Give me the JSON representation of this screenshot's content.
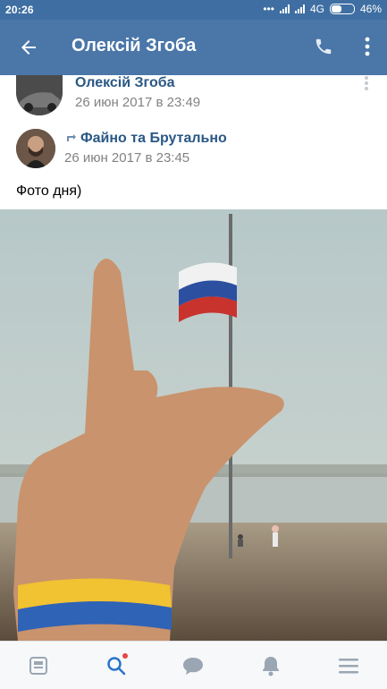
{
  "status_bar": {
    "time": "20:26",
    "network": "4G",
    "battery": "46%"
  },
  "header": {
    "title": "Олексій Згоба",
    "icons": [
      "back-arrow-icon",
      "phone-icon",
      "more-vertical-icon"
    ]
  },
  "post": {
    "author": "Олексій Згоба",
    "author_date": "26 июн 2017 в 23:49",
    "repost_source": "Файно та Брутально",
    "repost_date": "26 июн 2017 в 23:45",
    "text": "Фото дня)"
  },
  "tabbar": {
    "items": [
      "news-icon",
      "search-icon",
      "messages-icon",
      "notifications-icon",
      "menu-icon"
    ],
    "search_has_badge": true
  },
  "colors": {
    "header_bg": "#4a76a8",
    "statusbar_bg": "#3f6fa2",
    "link": "#2a5885",
    "accent_active": "#2a74c9"
  }
}
